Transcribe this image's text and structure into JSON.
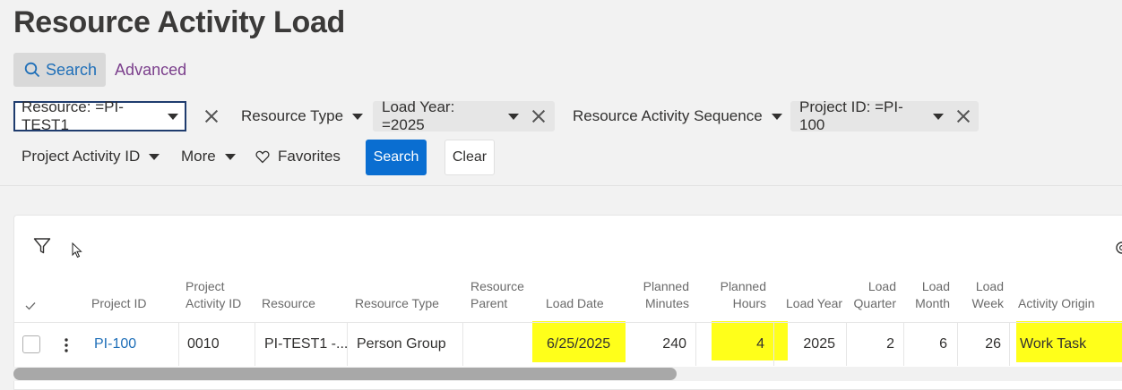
{
  "page": {
    "title": "Resource Activity Load"
  },
  "search_tabs": {
    "search": "Search",
    "advanced": "Advanced"
  },
  "filters": {
    "resource": "Resource: =PI-TEST1",
    "resource_type": "Resource Type",
    "load_year": "Load Year: =2025",
    "resource_activity_sequence": "Resource Activity Sequence",
    "project_id": "Project ID: =PI-100",
    "project_activity_id": "Project Activity ID",
    "more": "More",
    "favorites": "Favorites"
  },
  "actions": {
    "search": "Search",
    "clear": "Clear"
  },
  "table": {
    "headers": {
      "project_id": [
        "Project ID"
      ],
      "project_activity_id": [
        "Project",
        "Activity ID"
      ],
      "resource": [
        "Resource"
      ],
      "resource_type": [
        "Resource Type"
      ],
      "resource_parent": [
        "Resource",
        "Parent"
      ],
      "load_date": [
        "Load Date"
      ],
      "planned_minutes": [
        "Planned",
        "Minutes"
      ],
      "planned_hours": [
        "Planned",
        "Hours"
      ],
      "load_year": [
        "Load Year"
      ],
      "load_quarter": [
        "Load",
        "Quarter"
      ],
      "load_month": [
        "Load",
        "Month"
      ],
      "load_week": [
        "Load",
        "Week"
      ],
      "activity_origin": [
        "Activity Origin"
      ]
    },
    "rows": [
      {
        "project_id": "PI-100",
        "project_activity_id": "0010",
        "resource": "PI-TEST1 -...",
        "resource_type": "Person Group",
        "resource_parent": "",
        "load_date": "6/25/2025",
        "planned_minutes": "240",
        "planned_hours": "4",
        "load_year": "2025",
        "load_quarter": "2",
        "load_month": "6",
        "load_week": "26",
        "activity_origin": "Work Task"
      }
    ],
    "highlight_color": "#ffff1a"
  },
  "colors": {
    "primary": "#0a6ed1",
    "link": "#1f6fb8",
    "advanced": "#7b3f8c"
  }
}
